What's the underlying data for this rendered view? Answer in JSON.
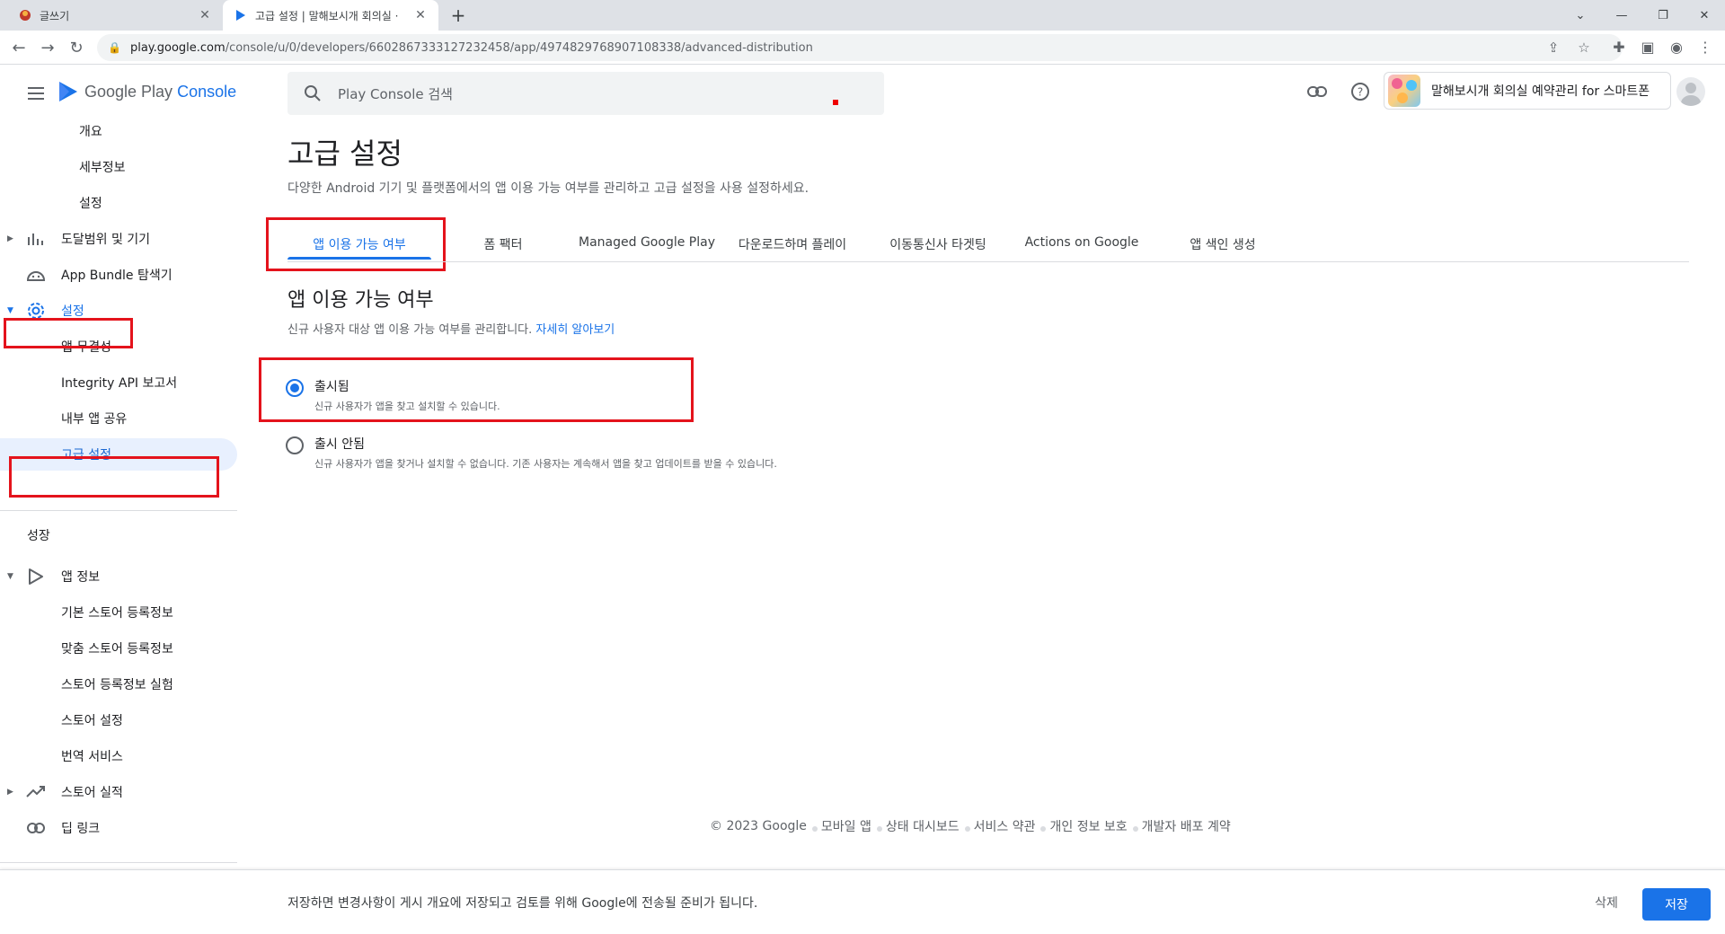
{
  "browser": {
    "tabs": [
      {
        "title": "글쓰기",
        "active": false
      },
      {
        "title": "고급 설정 | 말해보시개 회의실 ·",
        "active": true
      }
    ],
    "url_host": "play.google.com",
    "url_path": "/console/u/0/developers/6602867333127232458/app/4974829768907108338/advanced-distribution"
  },
  "header": {
    "logo_text_1": "Google Play",
    "logo_text_2": "Console",
    "search_placeholder": "Play Console 검색",
    "app_name": "말해보시개 회의실 예약관리 for 스마트폰"
  },
  "sidebar": {
    "sub_items_top": [
      "개요",
      "세부정보",
      "설정"
    ],
    "reach_devices": "도달범위 및 기기",
    "bundle_explorer": "App Bundle 탐색기",
    "settings": "설정",
    "settings_children": [
      "앱 무결성",
      "Integrity API 보고서",
      "내부 앱 공유",
      "고급 설정"
    ],
    "section_grow": "성장",
    "app_info": "앱 정보",
    "app_info_children": [
      "기본 스토어 등록정보",
      "맞춤 스토어 등록정보",
      "스토어 등록정보 실험",
      "스토어 설정",
      "번역 서비스"
    ],
    "store_performance": "스토어 실적",
    "deep_links": "딥 링크"
  },
  "main": {
    "title": "고급 설정",
    "description": "다양한 Android 기기 및 플랫폼에서의 앱 이용 가능 여부를 관리하고 고급 설정을 사용 설정하세요.",
    "tabs": [
      "앱 이용 가능 여부",
      "폼 팩터",
      "Managed Google Play",
      "다운로드하며 플레이",
      "이동통신사 타겟팅",
      "Actions on Google",
      "앱 색인 생성"
    ],
    "section_title": "앱 이용 가능 여부",
    "section_desc": "신규 사용자 대상 앱 이용 가능 여부를 관리합니다.",
    "learn_more": "자세히 알아보기",
    "options": [
      {
        "title": "출시됨",
        "desc": "신규 사용자가 앱을 찾고 설치할 수 있습니다.",
        "selected": true
      },
      {
        "title": "출시 안됨",
        "desc": "신규 사용자가 앱을 찾거나 설치할 수 없습니다. 기존 사용자는 계속해서 앱을 찾고 업데이트를 받을 수 있습니다.",
        "selected": false
      }
    ]
  },
  "footer": {
    "copyright": "© 2023 Google",
    "links": [
      "모바일 앱",
      "상태 대시보드",
      "서비스 약관",
      "개인 정보 보호",
      "개발자 배포 계약"
    ]
  },
  "savebar": {
    "message": "저장하면 변경사항이 게시 개요에 저장되고 검토를 위해 Google에 전송될 준비가 됩니다.",
    "delete_label": "삭제",
    "save_label": "저장"
  },
  "colors": {
    "accent": "#1a73e8",
    "highlight_box": "#e4131c",
    "selected_bg": "#e8f0fe"
  }
}
